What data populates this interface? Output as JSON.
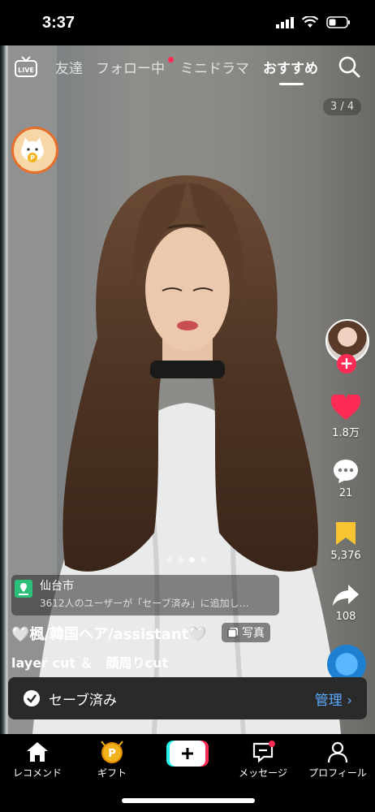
{
  "status": {
    "time": "3:37"
  },
  "topnav": {
    "live_label": "LIVE",
    "tabs": [
      {
        "label": "友達"
      },
      {
        "label": "フォロー中"
      },
      {
        "label": "ミニドラマ"
      },
      {
        "label": "おすすめ"
      }
    ]
  },
  "post": {
    "pager": "3 / 4",
    "likes": "1.8万",
    "comments": "21",
    "saves": "5,376",
    "shares": "108",
    "location": {
      "name": "仙台市",
      "subtitle": "3612人のユーザーが「セーブ済み」に追加し…"
    },
    "caption": "🤍楓/韓国ヘア/assistant🤍",
    "photo_badge": "写真",
    "caption_line2": "layer cut ＆　顔周りcut"
  },
  "toast": {
    "text": "セーブ済み",
    "action": "管理"
  },
  "bottomnav": {
    "items": [
      {
        "label": "レコメンド",
        "icon": "home-icon"
      },
      {
        "label": "ギフト",
        "icon": "gift-coin-icon"
      },
      {
        "label": "",
        "icon": "create-plus-icon"
      },
      {
        "label": "メッセージ",
        "icon": "inbox-icon"
      },
      {
        "label": "プロフィール",
        "icon": "profile-icon"
      }
    ]
  },
  "colors": {
    "accent_red": "#fe2c55",
    "save_yellow": "#f7c531",
    "link_blue": "#5aa9ff",
    "location_green": "#2bbf7a"
  }
}
